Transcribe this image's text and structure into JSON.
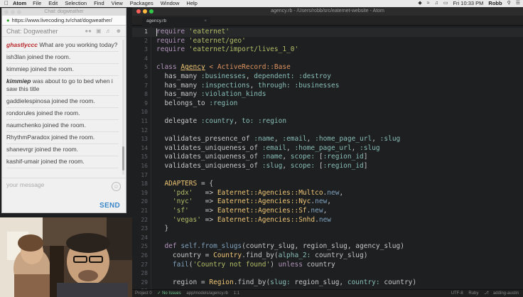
{
  "menubar": {
    "app_name": "Atom",
    "menus": [
      "File",
      "Edit",
      "Selection",
      "Find",
      "View",
      "Packages",
      "Window",
      "Help"
    ],
    "clock": "Fri 10:33 PM",
    "user": "Robb"
  },
  "chat_window": {
    "title": "Chat: dogweather",
    "url": "https://www.livecoding.tv/chat/dogweather/",
    "room_title": "Chat: Dogweather",
    "messages": [
      {
        "user": "ghastlyccc",
        "text": "What are you working today?",
        "style": "red"
      },
      {
        "user": "",
        "text": "ish3lan joined the room."
      },
      {
        "user": "",
        "text": "kimmiep joined the room."
      },
      {
        "user": "kimmiep",
        "text": "was about to go to bed when i saw this title",
        "style": "dark"
      },
      {
        "user": "",
        "text": "gaddielespinosa joined the room."
      },
      {
        "user": "",
        "text": "rondorules joined the room."
      },
      {
        "user": "",
        "text": "naumchenko joined the room."
      },
      {
        "user": "",
        "text": "RhythmParadox joined the room."
      },
      {
        "user": "",
        "text": "shanevrgr joined the room."
      },
      {
        "user": "",
        "text": "kashif-umair joined the room."
      }
    ],
    "composer_placeholder": "your message",
    "send_label": "SEND"
  },
  "atom": {
    "window_title": "agency.rb - /Users/robb/src/eaternet-website - Atom",
    "tab_label": "agency.rb",
    "current_line": 1,
    "status": {
      "project": "Project 0",
      "issues": "No Issues",
      "file_path": "app/models/agency.rb",
      "cursor_pos": "1:1",
      "encoding": "UTF-8",
      "grammar": "Ruby",
      "branch": "adding-austin"
    }
  }
}
